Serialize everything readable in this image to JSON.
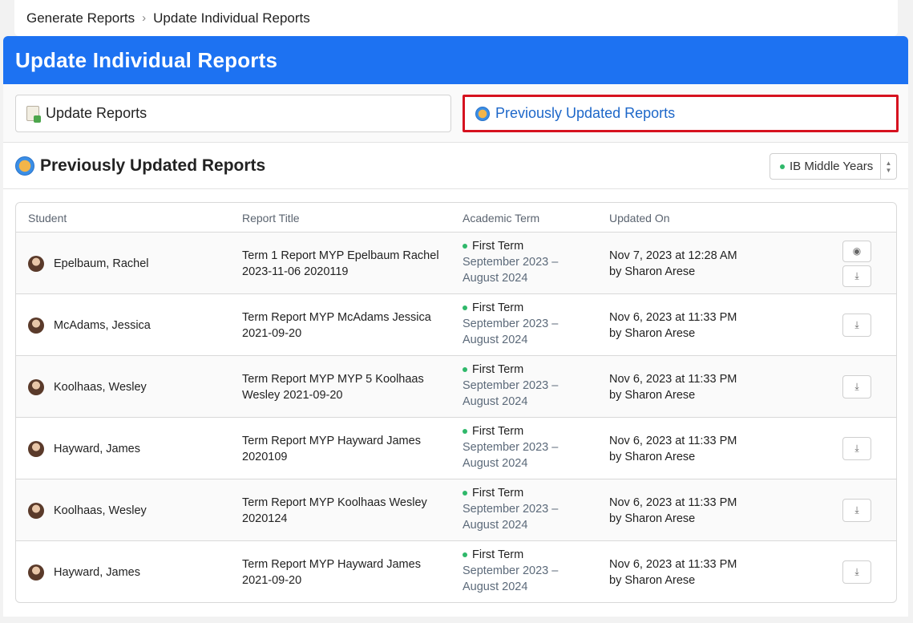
{
  "breadcrumb": {
    "items": [
      "Generate Reports",
      "Update Individual Reports"
    ],
    "separator": "›"
  },
  "page": {
    "title": "Update Individual Reports"
  },
  "tabs": {
    "update_label": "Update Reports",
    "previous_label": "Previously Updated Reports"
  },
  "section": {
    "title": "Previously Updated Reports",
    "program_select": "IB Middle Years"
  },
  "table": {
    "headers": {
      "student": "Student",
      "report_title": "Report Title",
      "academic_term": "Academic Term",
      "updated_on": "Updated On"
    },
    "rows": [
      {
        "student": "Epelbaum, Rachel",
        "title_line1": "Term 1 Report MYP Epelbaum Rachel",
        "title_line2": "2023-11-06 2020119",
        "term": "First Term",
        "term_dates1": "September 2023 –",
        "term_dates2": "August 2024",
        "updated": "Nov 7, 2023 at 12:28 AM",
        "by": "by Sharon Arese",
        "has_view": true
      },
      {
        "student": "McAdams, Jessica",
        "title_line1": "Term Report MYP McAdams Jessica",
        "title_line2": "2021-09-20",
        "term": "First Term",
        "term_dates1": "September 2023 –",
        "term_dates2": "August 2024",
        "updated": "Nov 6, 2023 at 11:33 PM",
        "by": "by Sharon Arese",
        "has_view": false
      },
      {
        "student": "Koolhaas, Wesley",
        "title_line1": "Term Report MYP MYP 5 Koolhaas",
        "title_line2": "Wesley 2021-09-20",
        "term": "First Term",
        "term_dates1": "September 2023 –",
        "term_dates2": "August 2024",
        "updated": "Nov 6, 2023 at 11:33 PM",
        "by": "by Sharon Arese",
        "has_view": false
      },
      {
        "student": "Hayward, James",
        "title_line1": "Term Report MYP Hayward James",
        "title_line2": "2020109",
        "term": "First Term",
        "term_dates1": "September 2023 –",
        "term_dates2": "August 2024",
        "updated": "Nov 6, 2023 at 11:33 PM",
        "by": "by Sharon Arese",
        "has_view": false
      },
      {
        "student": "Koolhaas, Wesley",
        "title_line1": "Term Report MYP Koolhaas Wesley",
        "title_line2": "2020124",
        "term": "First Term",
        "term_dates1": "September 2023 –",
        "term_dates2": "August 2024",
        "updated": "Nov 6, 2023 at 11:33 PM",
        "by": "by Sharon Arese",
        "has_view": false
      },
      {
        "student": "Hayward, James",
        "title_line1": "Term Report MYP Hayward James",
        "title_line2": "2021-09-20",
        "term": "First Term",
        "term_dates1": "September 2023 –",
        "term_dates2": "August 2024",
        "updated": "Nov 6, 2023 at 11:33 PM",
        "by": "by Sharon Arese",
        "has_view": false
      }
    ]
  },
  "icons": {
    "view": "eye-icon",
    "download": "download-icon",
    "clock": "clock-icon",
    "document": "document-icon"
  },
  "colors": {
    "header_blue": "#1d72f2",
    "highlight_red": "#d6121f",
    "link_blue": "#1d67c9",
    "status_green": "#2fb86a"
  }
}
